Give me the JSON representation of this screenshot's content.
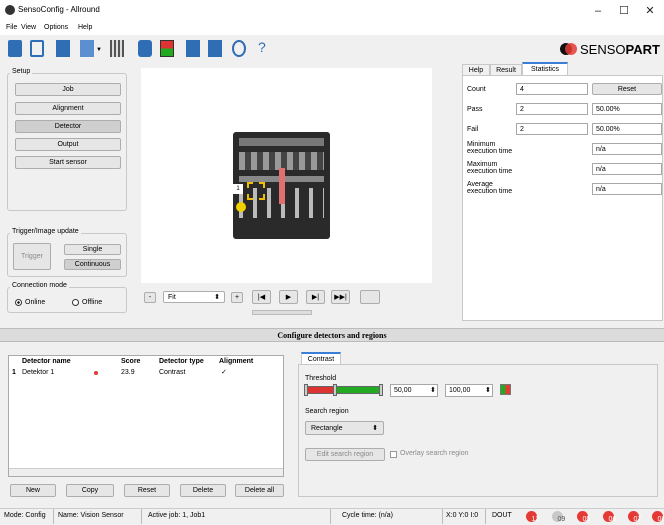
{
  "window": {
    "title": "SensoConfig - Allround",
    "min": "–",
    "max": "☐",
    "close": "✕"
  },
  "menu": [
    "File",
    "View",
    "Options",
    "Help"
  ],
  "brand": {
    "text_a": "SENSO",
    "text_b": "PART"
  },
  "setup": {
    "title": "Setup",
    "buttons": [
      "Job",
      "Alignment",
      "Detector",
      "Output",
      "Start sensor"
    ]
  },
  "trigger": {
    "title": "Trigger/Image update",
    "trigger": "Trigger",
    "single": "Single",
    "continuous": "Continuous"
  },
  "connection": {
    "title": "Connection mode",
    "online": "Online",
    "offline": "Offline"
  },
  "image_controls": {
    "minus": "-",
    "zoom": "Fit",
    "plus": "+",
    "first": "|◀",
    "play": "▶",
    "next": "▶|",
    "last": "▶▶|"
  },
  "image": {
    "label": "1"
  },
  "stats": {
    "tabs": [
      "Help",
      "Result",
      "Statistics"
    ],
    "count_label": "Count",
    "count": "4",
    "reset": "Reset",
    "pass_label": "Pass",
    "pass": "2",
    "pass_pct": "50.00%",
    "fail_label": "Fail",
    "fail": "2",
    "fail_pct": "50.00%",
    "min_label": "Minimum execution time",
    "min": "n/a",
    "max_label": "Maximum execution time",
    "max": "n/a",
    "avg_label": "Average execution time",
    "avg": "n/a"
  },
  "configure": {
    "title": "Configure detectors and regions"
  },
  "detectors": {
    "headers": [
      "Detector name",
      "Score",
      "Detector type",
      "Alignment"
    ],
    "rows": [
      {
        "index": "1",
        "name": "Detektor 1",
        "score": "23.9",
        "type": "Contrast",
        "alignment": "✓"
      }
    ],
    "buttons": [
      "New",
      "Copy",
      "Reset",
      "Delete",
      "Delete all"
    ]
  },
  "contrast": {
    "tab": "Contrast",
    "threshold_label": "Threshold",
    "low": "50,00",
    "high": "100,00",
    "search_region_label": "Search region",
    "search_region": "Rectangle",
    "edit_button": "Edit search region",
    "overlay_label": "Overlay search region"
  },
  "status": {
    "mode": "Mode:  Config",
    "name": "Name:  Vision Sensor",
    "job": "Active job:  1, Job1",
    "cycle": "Cycle time:  (n/a)",
    "xy": "X:0 Y:0 I:0",
    "dout": "DOUT",
    "outputs": [
      {
        "label": "12",
        "color": "#e53935"
      },
      {
        "label": "09",
        "color": "#c8c8c8"
      },
      {
        "label": "05",
        "color": "#e53935"
      },
      {
        "label": "06",
        "color": "#e53935"
      },
      {
        "label": "07",
        "color": "#e53935"
      },
      {
        "label": "08",
        "color": "#e53935"
      }
    ]
  }
}
